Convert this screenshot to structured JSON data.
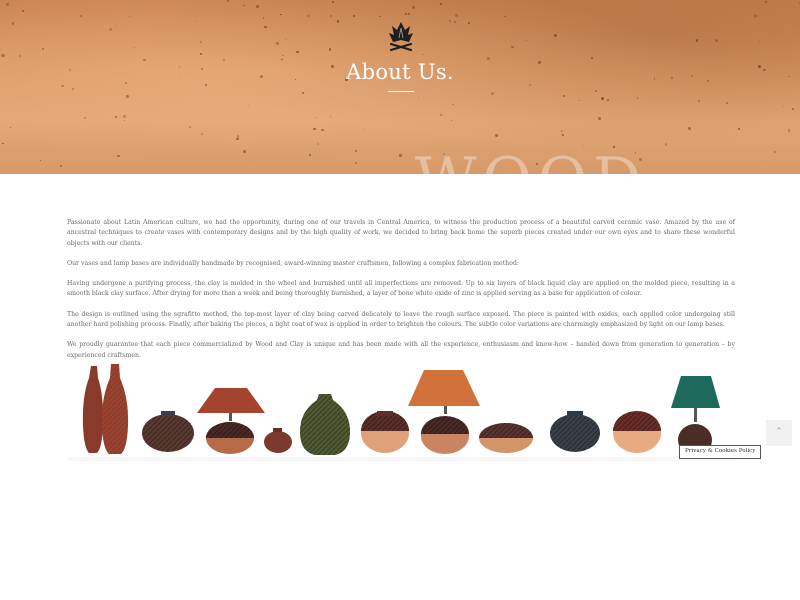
{
  "hero": {
    "logo_icon": "crossed-wood-logo-icon",
    "title": "About Us.",
    "watermark": "WOOD"
  },
  "content": {
    "paragraphs": [
      "Passionate about Latin American culture, we had the opportunity, during one of our travels in Central America, to witness the production process of a beautiful carved ceramic vase. Amazed by the use of  ancestral techniques to create vases with contemporary designs and by the high quality of work, we decided to bring back home the superb pieces created under our own eyes and to share these wonderful objects with our clients.",
      "Our vases and lamp bases are individually handmade by recognised, award-winning master craftsmen, following a complex fabrication method:",
      "Having undergone a purifying process, the clay is molded in the wheel and burnished until all imperfections are removed. Up to six layers of black liquid clay are applied on the molded piece, resulting in a smooth black clay surface. After drying for more than a week and being thoroughly burnished, a layer of bone white oxide of zinc is applied serving as a base for application of colour.",
      "The design is outlined using the sgrafitto method, the top-most layer of clay being carved delicately to leave the rough surface exposed. The piece is painted with oxides, each applied color undergoing still another hard polishing process. Finally, after baking the pieces, a light coat of wax is applied in order to brighten the colours. The subtle color variations are charmingly emphasized by light on our lamp bases.",
      "We proudly guarantee that each piece commercialized by Wood and Clay is unique and has been made with all the experience, enthusiasm and know-how – handed down from generation to generation – by experienced craftsmen."
    ]
  },
  "products": {
    "image": "ceramic-vases-and-lamps-image"
  },
  "ui": {
    "scroll_top_icon": "chevron-up-icon",
    "scroll_top_glyph": "˄",
    "cookie_link": "Privacy & Cookies Policy"
  }
}
